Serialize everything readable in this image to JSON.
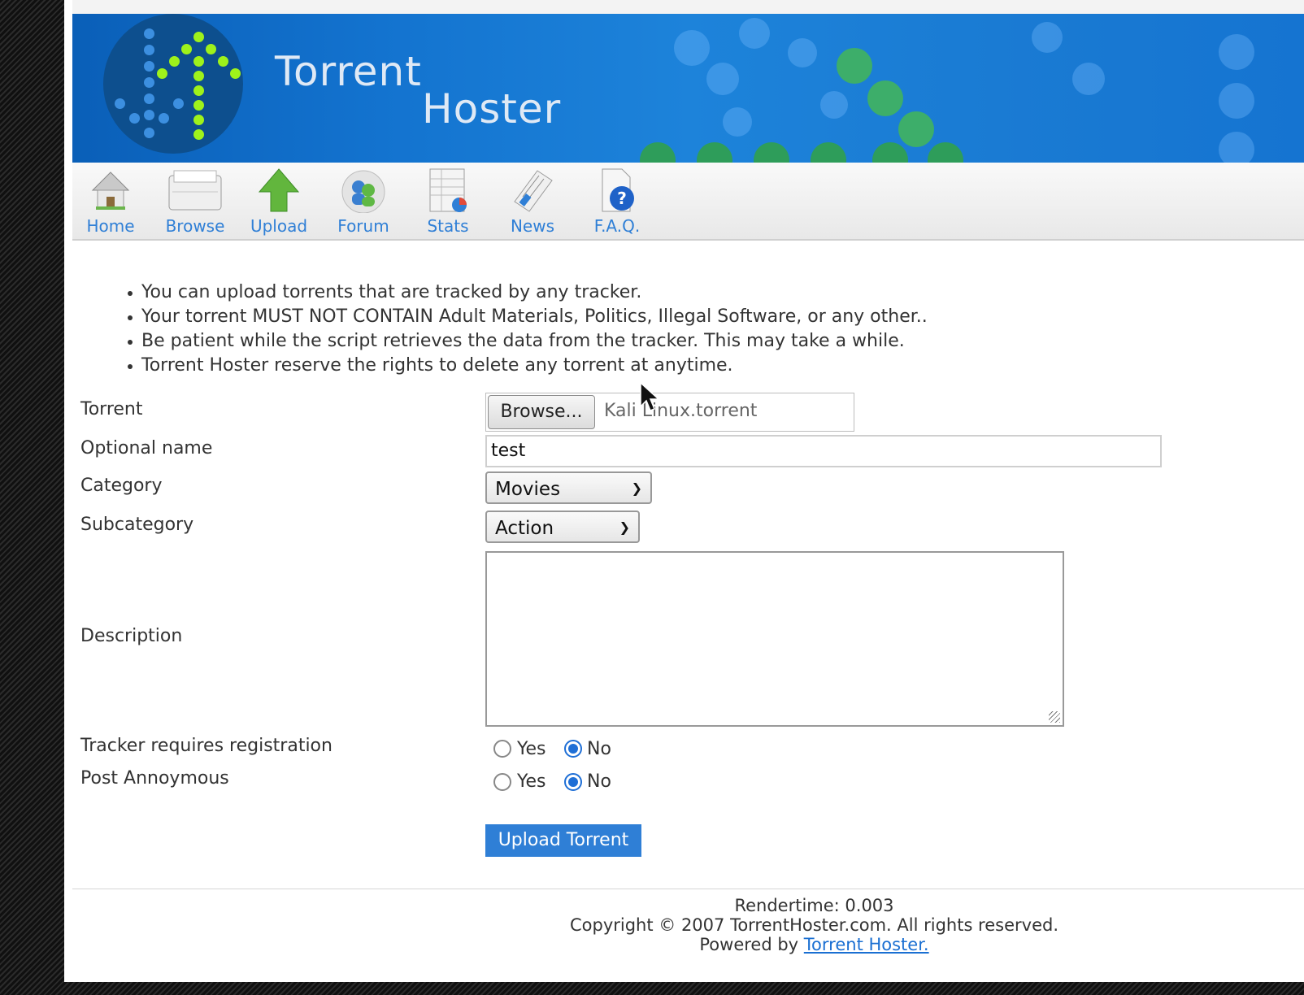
{
  "brand": {
    "line1": "Torrent",
    "line2": "Hoster"
  },
  "nav": [
    {
      "label": "Home",
      "icon": "home-icon"
    },
    {
      "label": "Browse",
      "icon": "browse-icon"
    },
    {
      "label": "Upload",
      "icon": "upload-arrow-icon"
    },
    {
      "label": "Forum",
      "icon": "forum-icon"
    },
    {
      "label": "Stats",
      "icon": "stats-icon"
    },
    {
      "label": "News",
      "icon": "news-icon"
    },
    {
      "label": "F.A.Q.",
      "icon": "help-icon"
    }
  ],
  "notes": [
    "You can upload torrents that are tracked by any tracker.",
    "Your torrent MUST NOT CONTAIN Adult Materials, Politics, Illegal Software, or any other..",
    "Be patient while the script retrieves the data from the tracker. This may take a while.",
    "Torrent Hoster reserve the rights to delete any torrent at anytime."
  ],
  "form": {
    "torrent_label": "Torrent",
    "browse_label": "Browse...",
    "file_name": "Kali Linux.torrent",
    "optional_name_label": "Optional name",
    "optional_name_value": "test",
    "category_label": "Category",
    "category_value": "Movies",
    "subcategory_label": "Subcategory",
    "subcategory_value": "Action",
    "description_label": "Description",
    "tracker_reg_label": "Tracker requires registration",
    "post_anon_label": "Post Annoymous",
    "yes_label": "Yes",
    "no_label": "No",
    "tracker_reg_selected": "No",
    "post_anon_selected": "No",
    "submit_label": "Upload Torrent"
  },
  "footer": {
    "rendertime": "Rendertime: 0.003",
    "copyright": "Copyright © 2007 TorrentHoster.com. All rights reserved.",
    "powered_prefix": "Powered by",
    "powered_link": "Torrent Hoster."
  },
  "colors": {
    "accent": "#2f7fd6",
    "banner": "#1373cf",
    "logo_green": "#9ef21b"
  }
}
